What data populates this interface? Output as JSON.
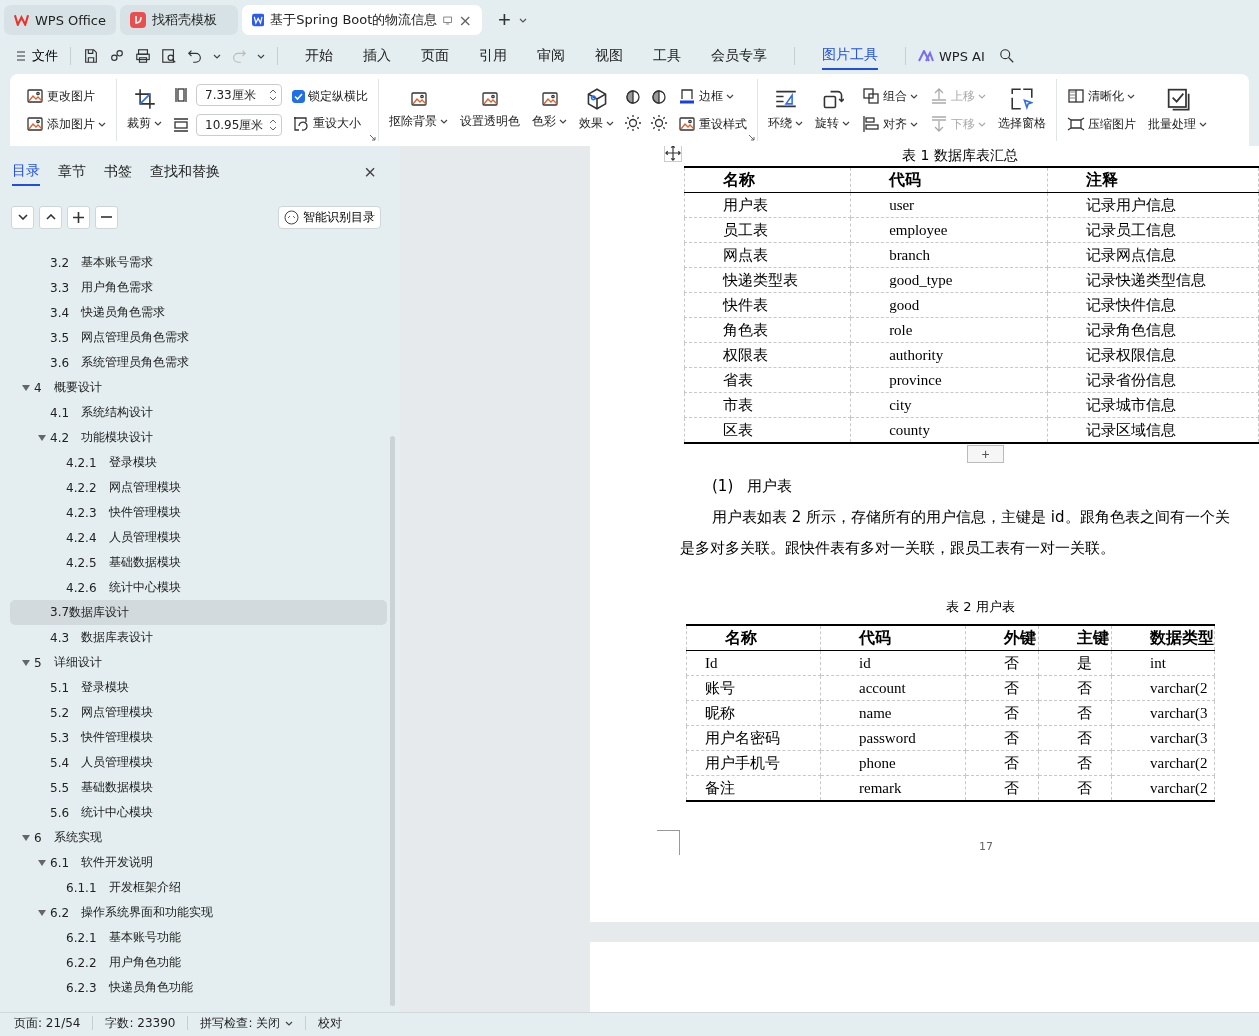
{
  "app_tabs": [
    {
      "kind": "wps",
      "label": "WPS Office",
      "selected": false
    },
    {
      "kind": "template",
      "label": "找稻壳模板",
      "selected": false
    },
    {
      "kind": "doc",
      "label": "基于Spring Boot的物流信息",
      "selected": true
    }
  ],
  "tab_close": "×",
  "new_tab": "+",
  "menu": {
    "file": "文件",
    "items": [
      {
        "label": "开始",
        "selected": false
      },
      {
        "label": "插入",
        "selected": false
      },
      {
        "label": "页面",
        "selected": false
      },
      {
        "label": "引用",
        "selected": false
      },
      {
        "label": "审阅",
        "selected": false
      },
      {
        "label": "视图",
        "selected": false
      },
      {
        "label": "工具",
        "selected": false
      },
      {
        "label": "会员专享",
        "selected": false
      }
    ],
    "context_items": [
      {
        "label": "图片工具",
        "selected": true
      }
    ],
    "ai": "WPS AI"
  },
  "ribbon": [
    {
      "columns": [
        [
          {
            "kind": "small",
            "label": "更改图片",
            "dropdown": false,
            "disabled": false
          },
          {
            "kind": "small",
            "label": "添加图片",
            "dropdown": true,
            "disabled": false
          }
        ]
      ]
    },
    {
      "launcher": true,
      "columns": [
        [
          {
            "kind": "big",
            "label": "裁剪",
            "dropdown": true,
            "disabled": false
          }
        ],
        [
          {
            "kind": "spin",
            "value": "7.33厘米"
          },
          {
            "kind": "spin",
            "value": "10.95厘米"
          }
        ],
        [
          {
            "kind": "check",
            "label": "锁定纵横比",
            "checked": true
          },
          {
            "kind": "small",
            "label": "重设大小",
            "dropdown": false,
            "disabled": false
          }
        ]
      ]
    },
    {
      "launcher": true,
      "columns": [
        [
          {
            "kind": "big",
            "label": "抠除背景",
            "dropdown": true,
            "disabled": false
          }
        ],
        [
          {
            "kind": "big",
            "label": "设置透明色",
            "dropdown": false,
            "disabled": false
          }
        ],
        [
          {
            "kind": "big",
            "label": "色彩",
            "dropdown": true,
            "disabled": false
          }
        ],
        [
          {
            "kind": "big",
            "label": "效果",
            "dropdown": true,
            "disabled": false
          }
        ],
        [
          {
            "kind": "icon"
          },
          {
            "kind": "icon"
          }
        ],
        [
          {
            "kind": "icon"
          },
          {
            "kind": "icon"
          }
        ],
        [
          {
            "kind": "small",
            "label": "边框",
            "dropdown": true,
            "disabled": false
          },
          {
            "kind": "small",
            "label": "重设样式",
            "dropdown": false,
            "disabled": false
          }
        ]
      ]
    },
    {
      "columns": [
        [
          {
            "kind": "big",
            "label": "环绕",
            "dropdown": true,
            "disabled": false
          }
        ],
        [
          {
            "kind": "big",
            "label": "旋转",
            "dropdown": true,
            "disabled": false
          }
        ],
        [
          {
            "kind": "small",
            "label": "组合",
            "dropdown": true,
            "disabled": false
          },
          {
            "kind": "small",
            "label": "对齐",
            "dropdown": true,
            "disabled": false
          }
        ],
        [
          {
            "kind": "small",
            "label": "上移",
            "dropdown": true,
            "disabled": true
          },
          {
            "kind": "small",
            "label": "下移",
            "dropdown": true,
            "disabled": true
          }
        ],
        [
          {
            "kind": "big",
            "label": "选择窗格",
            "dropdown": false,
            "disabled": false
          }
        ]
      ]
    },
    {
      "columns": [
        [
          {
            "kind": "small",
            "label": "清晰化",
            "dropdown": true,
            "disabled": false
          },
          {
            "kind": "small",
            "label": "压缩图片",
            "dropdown": false,
            "disabled": false
          }
        ],
        [
          {
            "kind": "big",
            "label": "批量处理",
            "dropdown": true,
            "disabled": false
          }
        ]
      ]
    }
  ],
  "nav": {
    "tabs": [
      {
        "label": "目录",
        "selected": true
      },
      {
        "label": "章节",
        "selected": false
      },
      {
        "label": "书签",
        "selected": false
      },
      {
        "label": "查找和替换",
        "selected": false
      }
    ],
    "close": "×",
    "smart_button": "智能识别目录",
    "items": [
      {
        "children": [
          {
            "num": "3.2",
            "label": "基本账号需求",
            "selected": false
          },
          {
            "num": "3.3",
            "label": "用户角色需求",
            "selected": false
          },
          {
            "num": "3.4",
            "label": "快递员角色需求",
            "selected": false
          },
          {
            "num": "3.5",
            "label": "网点管理员角色需求",
            "selected": false
          },
          {
            "num": "3.6",
            "label": "系统管理员角色需求",
            "selected": false
          }
        ]
      },
      {
        "num": "4",
        "label": "概要设计",
        "selected": false,
        "expanded": true,
        "children": [
          {
            "num": "4.1",
            "label": "系统结构设计",
            "selected": false
          },
          {
            "num": "4.2",
            "label": "功能模块设计",
            "selected": false,
            "expanded": true,
            "children": [
              {
                "num": "4.2.1",
                "label": "登录模块",
                "selected": false
              },
              {
                "num": "4.2.2",
                "label": "网点管理模块",
                "selected": false
              },
              {
                "num": "4.2.3",
                "label": "快件管理模块",
                "selected": false
              },
              {
                "num": "4.2.4",
                "label": "人员管理模块",
                "selected": false
              },
              {
                "num": "4.2.5",
                "label": "基础数据模块",
                "selected": false
              },
              {
                "num": "4.2.6",
                "label": "统计中心模块",
                "selected": false
              }
            ]
          },
          {
            "label": "3.7数据库设计",
            "selected": true
          },
          {
            "num": "4.3",
            "label": "数据库表设计",
            "selected": false
          }
        ]
      },
      {
        "num": "5",
        "label": "详细设计",
        "selected": false,
        "expanded": true,
        "children": [
          {
            "num": "5.1",
            "label": "登录模块",
            "selected": false
          },
          {
            "num": "5.2",
            "label": "网点管理模块",
            "selected": false
          },
          {
            "num": "5.3",
            "label": "快件管理模块",
            "selected": false
          },
          {
            "num": "5.4",
            "label": "人员管理模块",
            "selected": false
          },
          {
            "num": "5.5",
            "label": "基础数据模块",
            "selected": false
          },
          {
            "num": "5.6",
            "label": "统计中心模块",
            "selected": false
          }
        ]
      },
      {
        "num": "6",
        "label": "系统实现",
        "selected": false,
        "expanded": true,
        "children": [
          {
            "num": "6.1",
            "label": "软件开发说明",
            "selected": false,
            "expanded": true,
            "children": [
              {
                "num": "6.1.1",
                "label": "开发框架介绍",
                "selected": false
              }
            ]
          },
          {
            "num": "6.2",
            "label": "操作系统界面和功能实现",
            "selected": false,
            "expanded": true,
            "children": [
              {
                "num": "6.2.1",
                "label": "基本账号功能",
                "selected": false
              },
              {
                "num": "6.2.2",
                "label": "用户角色功能",
                "selected": false
              },
              {
                "num": "6.2.3",
                "label": "快递员角色功能",
                "selected": false
              }
            ]
          }
        ]
      }
    ]
  },
  "doc": {
    "table1": {
      "caption": "表 1 数据库表汇总",
      "columns": [
        "名称",
        "代码",
        "注释"
      ],
      "rows": [
        [
          "用户表",
          "user",
          "记录用户信息"
        ],
        [
          "员工表",
          "employee",
          "记录员工信息"
        ],
        [
          "网点表",
          "branch",
          "记录网点信息"
        ],
        [
          "快递类型表",
          "good_type",
          "记录快递类型信息"
        ],
        [
          "快件表",
          "good",
          "记录快件信息"
        ],
        [
          "角色表",
          "role",
          "记录角色信息"
        ],
        [
          "权限表",
          "authority",
          "记录权限信息"
        ],
        [
          "省表",
          "province",
          "记录省份信息"
        ],
        [
          "市表",
          "city",
          "记录城市信息"
        ],
        [
          "区表",
          "county",
          "记录区域信息"
        ]
      ]
    },
    "add_row": "+",
    "heading": {
      "number": "(1)",
      "title": "用户表"
    },
    "paragraph_lines": [
      "用户表如表 2 所示，存储所有的用户信息，主键是 id。跟角色表之间有一个关",
      "是多对多关联。跟快件表有多对一关联，跟员工表有一对一关联。"
    ],
    "table2": {
      "caption": "表 2  用户表",
      "columns": [
        "名称",
        "代码",
        "外键",
        "主键",
        "数据类型"
      ],
      "rows": [
        [
          "Id",
          "id",
          "否",
          "是",
          "int"
        ],
        [
          "账号",
          "account",
          "否",
          "否",
          "varchar(2"
        ],
        [
          "昵称",
          "name",
          "否",
          "否",
          "varchar(3"
        ],
        [
          "用户名密码",
          "password",
          "否",
          "否",
          "varchar(3"
        ],
        [
          "用户手机号",
          "phone",
          "否",
          "否",
          "varchar(2"
        ],
        [
          "备注",
          "remark",
          "否",
          "否",
          "varchar(2"
        ]
      ]
    },
    "page_number": "17"
  },
  "status_bar": [
    {
      "label": "页面: 21/54",
      "dropdown": false
    },
    {
      "label": "字数: 23390",
      "dropdown": false
    },
    {
      "label": "拼写检查: 关闭",
      "dropdown": true
    },
    {
      "label": "校对",
      "dropdown": false
    }
  ]
}
